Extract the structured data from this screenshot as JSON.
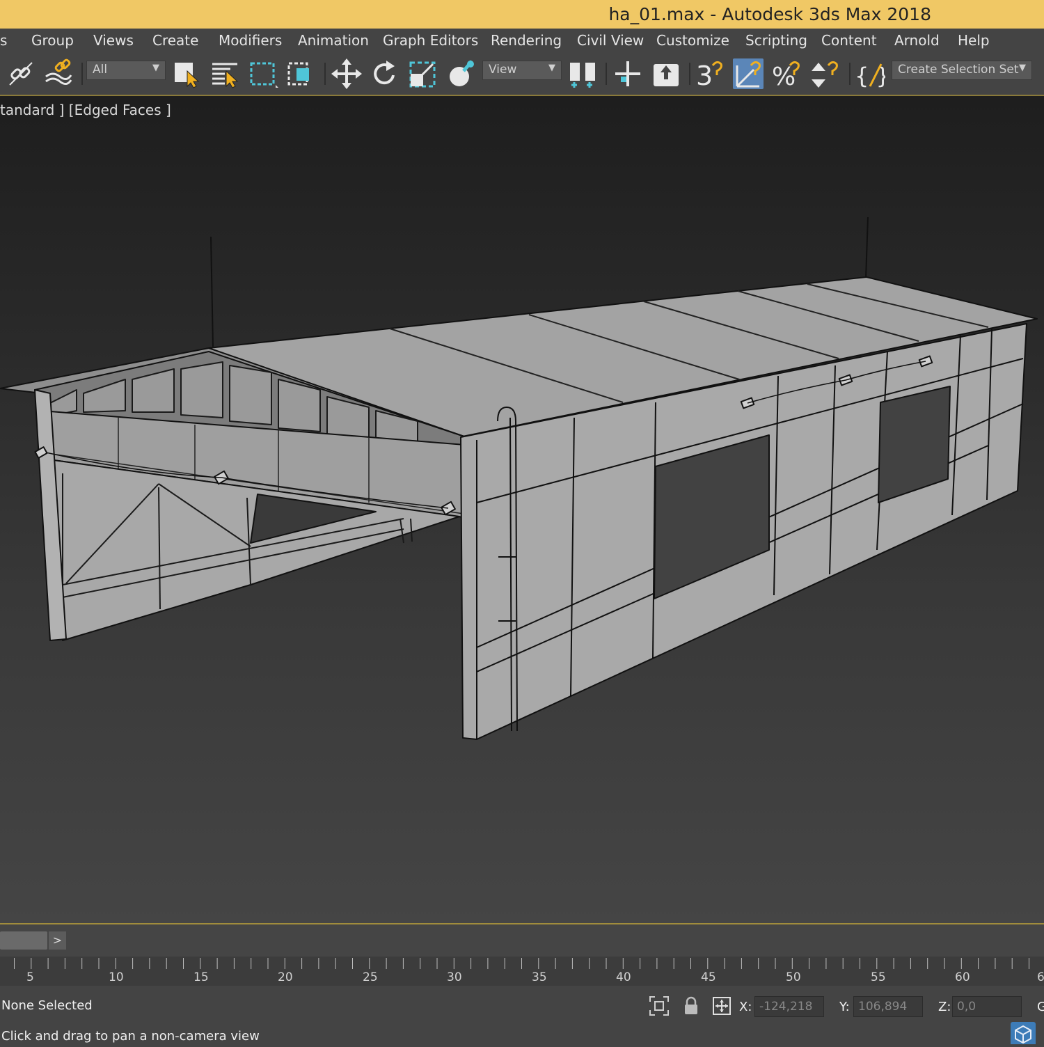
{
  "window": {
    "title": "ha_01.max - Autodesk 3ds Max 2018"
  },
  "menu": {
    "items": [
      "s",
      "Group",
      "Views",
      "Create",
      "Modifiers",
      "Animation",
      "Graph Editors",
      "Rendering",
      "Civil View",
      "Customize",
      "Scripting",
      "Content",
      "Arnold",
      "Help"
    ]
  },
  "toolbar": {
    "selection_filter": "All",
    "reference_coord": "View",
    "named_selection": "Create Selection Set",
    "icons": [
      "link-icon",
      "unlink-icon",
      "select-object-icon",
      "select-by-name-icon",
      "rectangular-selection-icon",
      "window-crossing-icon",
      "move-icon",
      "rotate-icon",
      "scale-icon",
      "place-icon",
      "mirror-icon",
      "pivot-icon",
      "align-icon",
      "snap-3d-icon",
      "angle-snap-icon",
      "percent-snap-icon",
      "spinner-snap-icon",
      "named-selection-icon"
    ],
    "accent_color": "#f0c865",
    "active_icon_bg": "#5b86b8"
  },
  "viewport": {
    "label": "tandard ] [Edged Faces ]"
  },
  "timeline": {
    "slider_arrow": ">",
    "ticks": [
      "5",
      "10",
      "15",
      "20",
      "25",
      "30",
      "35",
      "40",
      "45",
      "50",
      "55",
      "60",
      "6"
    ]
  },
  "status": {
    "selection": "None Selected",
    "prompt": "Click and drag to pan a non-camera view",
    "x_label": "X:",
    "x_value": "-124,218",
    "y_label": "Y:",
    "y_value": "106,894",
    "z_label": "Z:",
    "z_value": "0,0",
    "grid_label": "G"
  }
}
